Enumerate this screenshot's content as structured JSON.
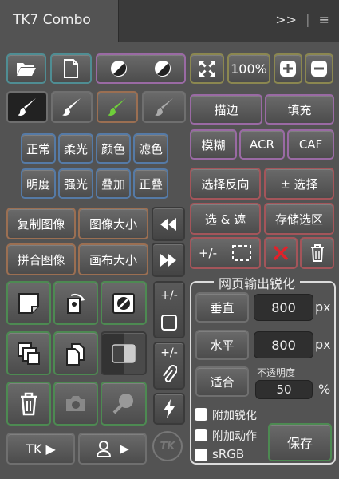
{
  "panel": {
    "title": "TK7 Combo",
    "top_icons": ">>",
    "menu_icon": "≡"
  },
  "row1": {
    "zoom": "100%"
  },
  "paint": {
    "stroke": "描边",
    "fill": "填充",
    "blur": "模糊",
    "acr": "ACR",
    "caf": "CAF"
  },
  "blend": {
    "labels": [
      "正常",
      "柔光",
      "颜色",
      "滤色",
      "明度",
      "强光",
      "叠加",
      "正叠"
    ]
  },
  "select": {
    "invert": "选择反向",
    "plusminus": "± 选择",
    "select_mask": "选 & 遮",
    "save_sel": "存储选区",
    "plusminus_short": "+/-"
  },
  "image": {
    "dup": "复制图像",
    "img_size": "图像大小",
    "flatten": "拼合图像",
    "canvas_size": "画布大小"
  },
  "sharpen": {
    "title": "网页输出锐化",
    "vertical": "垂直",
    "vertical_value": "800",
    "horizontal": "水平",
    "horizontal_value": "800",
    "unit": "px",
    "fit": "适合",
    "opacity_label": "不透明度",
    "opacity_value": "50",
    "percent": "%",
    "opt1": "附加锐化",
    "opt2": "附加动作",
    "opt3": "sRGB",
    "save": "保存"
  },
  "bottom": {
    "tk": "TK ▶",
    "user_arrow": "▶",
    "logo": "TK"
  },
  "mid": {
    "pm1": "+/-",
    "pm2": "+/-"
  },
  "colors": {
    "bg": "#535353",
    "teal": "#4f8d93",
    "purple": "#9a6aa4",
    "olive": "#8b8750",
    "red_x": "#e0222a",
    "green_brush": "#6fcf3a"
  }
}
